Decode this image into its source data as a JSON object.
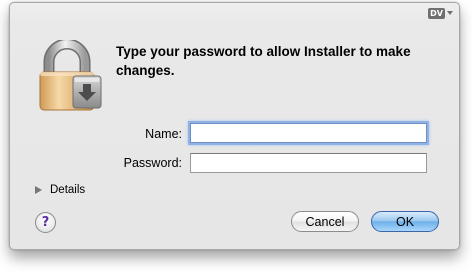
{
  "window": {
    "input_method_badge": "DV"
  },
  "dialog": {
    "message": "Type your password to allow Installer to make changes.",
    "name_label": "Name:",
    "name_value": "",
    "password_label": "Password:",
    "password_value": "",
    "details_label": "Details",
    "help_label": "?",
    "cancel_label": "Cancel",
    "ok_label": "OK"
  },
  "icons": {
    "lock": "padlock-icon",
    "input_menu": "input-menu-icon",
    "details": "disclosure-triangle-icon",
    "help": "help-icon"
  },
  "colors": {
    "focus_ring": "#8fb3e6",
    "default_button": "#6fb0ea",
    "help_question_mark": "#5a2ea6"
  }
}
